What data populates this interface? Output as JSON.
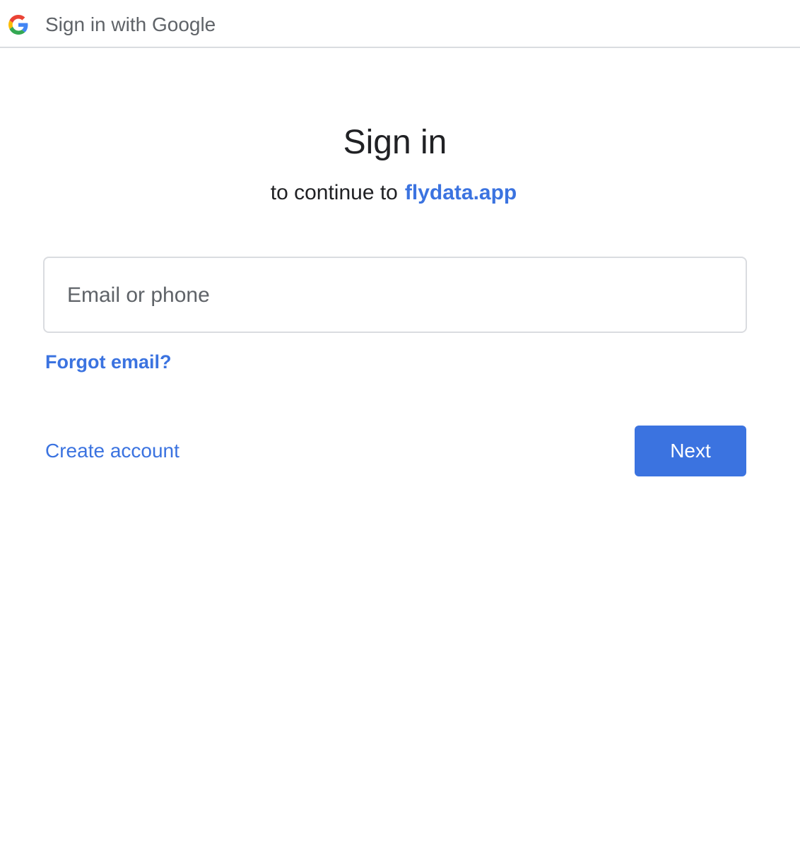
{
  "header": {
    "title": "Sign in with Google",
    "logo_icon": "google-g-icon"
  },
  "main": {
    "heading": "Sign in",
    "subheading_prefix": "to continue to",
    "app_name": "flydata.app"
  },
  "form": {
    "email_placeholder": "Email or phone",
    "email_value": "",
    "forgot_email_label": "Forgot email?",
    "create_account_label": "Create account",
    "next_label": "Next"
  },
  "colors": {
    "accent": "#3b73e0",
    "text_primary": "#202124",
    "text_secondary": "#5f6368",
    "border": "#dadce0",
    "google_blue": "#4285F4",
    "google_red": "#EA4335",
    "google_yellow": "#FBBC05",
    "google_green": "#34A853"
  }
}
